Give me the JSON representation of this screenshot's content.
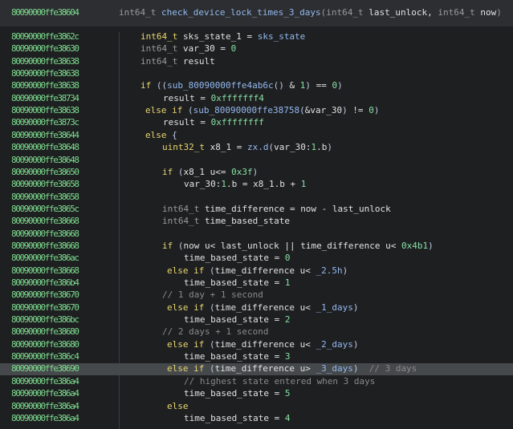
{
  "header": {
    "address": "80090000ffe38604",
    "signature": "int64_t check_device_lock_times_3_days(int64_t last_unlock, int64_t now)"
  },
  "colors": {
    "address": "#7ddc8e",
    "keyword": "#e8d56e",
    "number": "#86e0a2",
    "function": "#93b9ef",
    "highlight_row": "#45494b"
  },
  "lines": [
    {
      "addr": "80090000ffe3862c",
      "code": "int64_t sks_state_1 = sks_state"
    },
    {
      "addr": "80090000ffe38630",
      "code": "int64_t var_30 = 0"
    },
    {
      "addr": "80090000ffe38638",
      "code": "int64_t result"
    },
    {
      "addr": "80090000ffe38638",
      "code": ""
    },
    {
      "addr": "80090000ffe38638",
      "code": "if ((sub_80090000ffe4ab6c() & 1) == 0)"
    },
    {
      "addr": "80090000ffe38734",
      "code": "result = 0xfffffff4"
    },
    {
      "addr": "80090000ffe38638",
      "code": "else if (sub_80090000ffe38758(&var_30) != 0)"
    },
    {
      "addr": "80090000ffe3873c",
      "code": "result = 0xffffffff"
    },
    {
      "addr": "80090000ffe38644",
      "code": "else {"
    },
    {
      "addr": "80090000ffe38648",
      "code": "uint32_t x8_1 = zx.d(var_30:1.b)"
    },
    {
      "addr": "80090000ffe38648",
      "code": ""
    },
    {
      "addr": "80090000ffe38650",
      "code": "if (x8_1 u<= 0x3f)"
    },
    {
      "addr": "80090000ffe38658",
      "code": "var_30:1.b = x8_1.b + 1"
    },
    {
      "addr": "80090000ffe38658",
      "code": ""
    },
    {
      "addr": "80090000ffe3865c",
      "code": "int64_t time_difference = now - last_unlock"
    },
    {
      "addr": "80090000ffe38668",
      "code": "int64_t time_based_state"
    },
    {
      "addr": "80090000ffe38668",
      "code": ""
    },
    {
      "addr": "80090000ffe38668",
      "code": "if (now u< last_unlock || time_difference u< 0x4b1)"
    },
    {
      "addr": "80090000ffe386ac",
      "code": "time_based_state = 0"
    },
    {
      "addr": "80090000ffe38668",
      "code": "else if (time_difference u< _2.5h)"
    },
    {
      "addr": "80090000ffe386b4",
      "code": "time_based_state = 1"
    },
    {
      "addr": "80090000ffe38670",
      "code": "// 1 day + 1 second"
    },
    {
      "addr": "80090000ffe38670",
      "code": "else if (time_difference u< _1_days)"
    },
    {
      "addr": "80090000ffe386bc",
      "code": "time_based_state = 2"
    },
    {
      "addr": "80090000ffe38680",
      "code": "// 2 days + 1 second"
    },
    {
      "addr": "80090000ffe38680",
      "code": "else if (time_difference u< _2_days)"
    },
    {
      "addr": "80090000ffe386c4",
      "code": "time_based_state = 3"
    },
    {
      "addr": "80090000ffe38690",
      "code": "else if (time_difference u> _3_days)  // 3 days",
      "selected": true
    },
    {
      "addr": "80090000ffe386a4",
      "code": "// highest state entered when 3 days"
    },
    {
      "addr": "80090000ffe386a4",
      "code": "time_based_state = 5"
    },
    {
      "addr": "80090000ffe386a4",
      "code": "else"
    },
    {
      "addr": "80090000ffe386a4",
      "code": "time_based_state = 4"
    }
  ]
}
